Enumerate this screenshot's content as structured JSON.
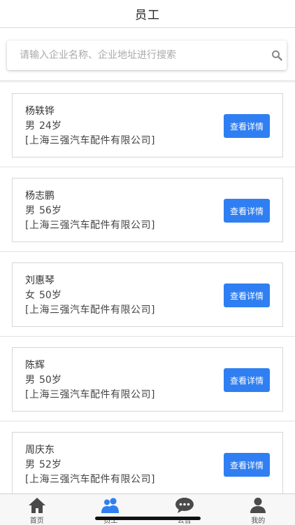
{
  "header": {
    "title": "员工"
  },
  "search": {
    "placeholder": "请输入企业名称、企业地址进行搜索"
  },
  "employees": [
    {
      "name": "杨轶铧",
      "gender": "男",
      "age": "24岁",
      "company": "[上海三强汽车配件有限公司]",
      "button": "查看详情"
    },
    {
      "name": "杨志鹏",
      "gender": "男",
      "age": "56岁",
      "company": "[上海三强汽车配件有限公司]",
      "button": "查看详情"
    },
    {
      "name": "刘惠琴",
      "gender": "女",
      "age": "50岁",
      "company": "[上海三强汽车配件有限公司]",
      "button": "查看详情"
    },
    {
      "name": "陈辉",
      "gender": "男",
      "age": "50岁",
      "company": "[上海三强汽车配件有限公司]",
      "button": "查看详情"
    },
    {
      "name": "周庆东",
      "gender": "男",
      "age": "52岁",
      "company": "[上海三强汽车配件有限公司]",
      "button": "查看详情"
    }
  ],
  "tabbar": {
    "items": [
      {
        "label": "首页",
        "icon": "home-icon"
      },
      {
        "label": "员工",
        "icon": "employees-icon",
        "active": true
      },
      {
        "label": "公告",
        "icon": "chat-bubble-icon"
      },
      {
        "label": "我的",
        "icon": "user-icon"
      }
    ]
  },
  "colors": {
    "accent": "#2f7ff2",
    "icon_dark": "#4a4a4a",
    "icon_active": "#2f7ff2"
  }
}
